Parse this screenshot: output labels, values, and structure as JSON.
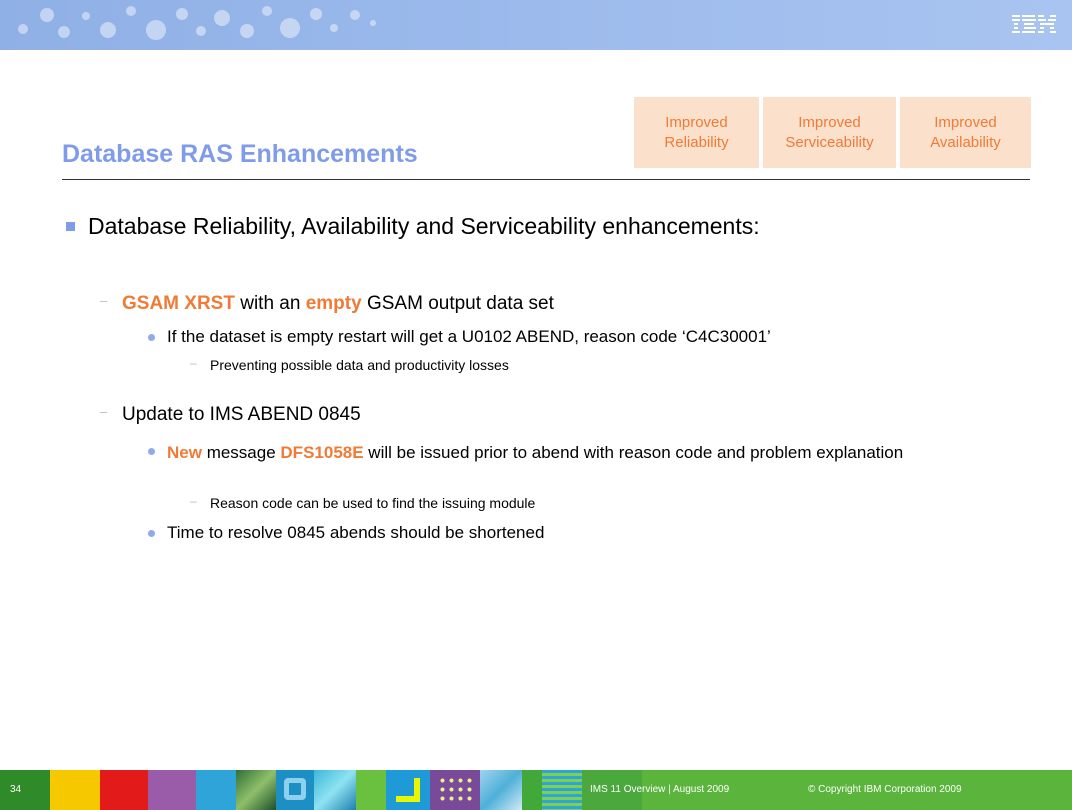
{
  "header": {
    "title": "Database RAS Enhancements",
    "logo_text": "IBM",
    "tags": [
      {
        "line1": "Improved",
        "line2": "Reliability"
      },
      {
        "line1": "Improved",
        "line2": "Serviceability"
      },
      {
        "line1": "Improved",
        "line2": "Availability"
      }
    ]
  },
  "content": {
    "main_point": "Database Reliability, Availability and Serviceability enhancements:",
    "item1": {
      "hl1": "GSAM XRST",
      "t1": " with an ",
      "hl2": "empty",
      "t2": " GSAM output data set",
      "bullet": "If the dataset is empty restart will get a U0102 ABEND, reason code ‘C4C30001’",
      "sub": "Preventing possible data and productivity losses"
    },
    "item2": {
      "text": "Update to IMS ABEND 0845",
      "bullet1_hl1": "New",
      "bullet1_t1": " message ",
      "bullet1_hl2": "DFS1058E",
      "bullet1_t2": " will be issued prior to abend with reason code and problem explanation",
      "sub": "Reason code can be used to find the issuing module",
      "bullet2": "Time to resolve 0845 abends should be shortened"
    }
  },
  "footer": {
    "page_number": "34",
    "title": "IMS 11 Overview  |  August 2009",
    "copyright": "© Copyright IBM Corporation 2009"
  },
  "colors": {
    "accent_blue": "#7f9bea",
    "accent_orange": "#f07a36",
    "tag_bg": "#fbe1cc",
    "footer_green": "#5bb53c"
  }
}
